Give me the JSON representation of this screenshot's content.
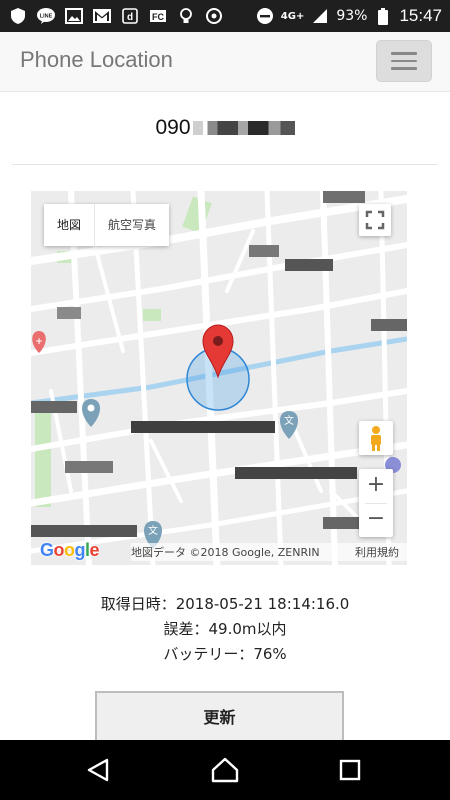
{
  "status_bar": {
    "time": "15:47",
    "battery": "93%",
    "network": "4G+",
    "icons": [
      "shield-icon",
      "line-icon",
      "gallery-icon",
      "gmail-icon",
      "docomo-icon",
      "news-icon",
      "bulb-icon",
      "game-icon",
      "dnd-icon",
      "signal-icon",
      "battery-icon"
    ]
  },
  "header": {
    "title": "Phone Location",
    "menu_icon": "hamburger-icon"
  },
  "phone": {
    "number_prefix": "090"
  },
  "map": {
    "type_buttons": [
      "地図",
      "航空写真"
    ],
    "attribution": "地図データ ©2018 Google, ZENRIN",
    "terms": "利用規約",
    "logo": "Google",
    "zoom_in": "+",
    "zoom_out": "−",
    "marker_color": "#e53935",
    "accuracy_color": "#4a9fe6",
    "poi_school": "文"
  },
  "info": {
    "acquired": "取得日時：2018-05-21 18:14:16.0",
    "error": "誤差：49.0m以内",
    "battery": "バッテリー：76%"
  },
  "actions": {
    "refresh": "更新"
  },
  "nav": {
    "back_icon": "back-triangle-icon",
    "home_icon": "home-icon",
    "recents_icon": "recents-square-icon"
  }
}
